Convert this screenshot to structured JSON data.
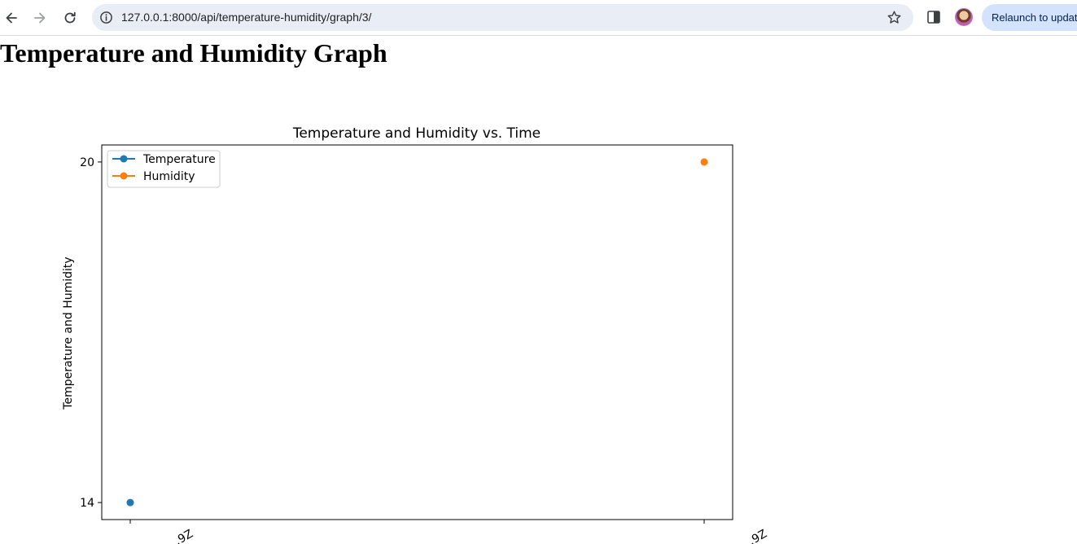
{
  "browser": {
    "url": "127.0.0.1:8000/api/temperature-humidity/graph/3/",
    "relaunch_label": "Relaunch to update"
  },
  "page": {
    "title": "Temperature and Humidity Graph"
  },
  "colors": {
    "temperature": "#1f77b4",
    "humidity": "#ff7f0e"
  },
  "chart_data": {
    "type": "line",
    "title": "Temperature and Humidity vs. Time",
    "xlabel": "",
    "ylabel": "Temperature and Humidity",
    "x_tick_labels": [
      "…9Z",
      "…9Z"
    ],
    "yticks": [
      14,
      20
    ],
    "ylim": [
      13.7,
      20.3
    ],
    "legend_position": "upper-left",
    "grid": false,
    "series": [
      {
        "name": "Temperature",
        "color": "#1f77b4",
        "points": [
          {
            "x_index": 0,
            "y": 14
          }
        ]
      },
      {
        "name": "Humidity",
        "color": "#ff7f0e",
        "points": [
          {
            "x_index": 1,
            "y": 20
          }
        ]
      }
    ]
  }
}
